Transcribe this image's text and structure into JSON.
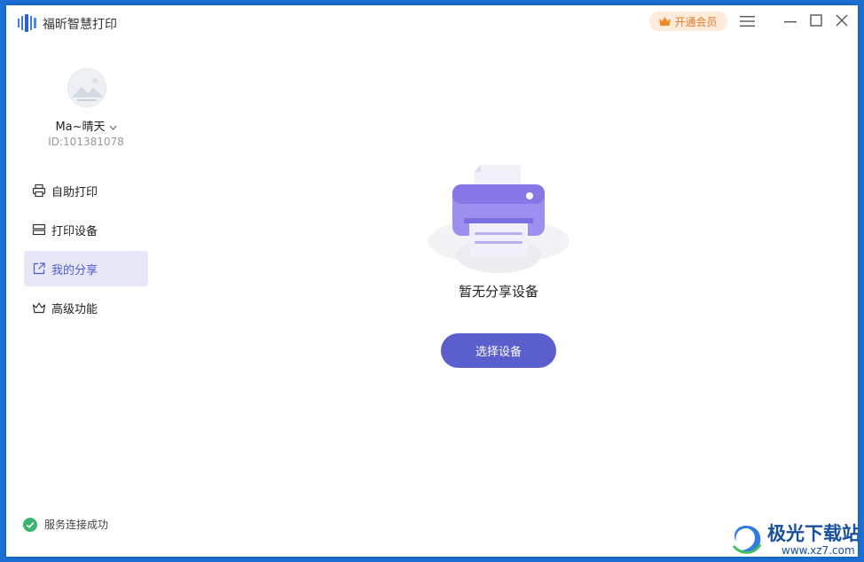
{
  "app": {
    "title": "福昕智慧打印",
    "icon": "barcode-logo-icon"
  },
  "header": {
    "vip_label": "开通会员",
    "vip_icon": "crown-icon",
    "menu_icon": "hamburger-menu-icon",
    "window_controls": [
      "minimize-icon",
      "maximize-icon",
      "close-icon"
    ]
  },
  "user": {
    "name": "Ma~晴天",
    "id_label": "ID:101381078"
  },
  "sidebar": {
    "items": [
      {
        "label": "自助打印",
        "icon": "printer-icon",
        "active": false
      },
      {
        "label": "打印设备",
        "icon": "device-stack-icon",
        "active": false
      },
      {
        "label": "我的分享",
        "icon": "share-external-icon",
        "active": true
      },
      {
        "label": "高级功能",
        "icon": "crown-outline-icon",
        "active": false
      }
    ]
  },
  "main": {
    "empty_text": "暂无分享设备",
    "select_button": "选择设备"
  },
  "status": {
    "text": "服务连接成功",
    "icon": "check-circle-icon",
    "color": "#3cb371"
  },
  "watermark": {
    "brand": "极光下载站",
    "url": "www.xz7.com"
  },
  "colors": {
    "accent": "#5b5fcd",
    "active_bg": "#e6e8f7",
    "vip_bg": "#fdecdc",
    "vip_text": "#e5792a",
    "desktop": "#1a6fd1"
  }
}
